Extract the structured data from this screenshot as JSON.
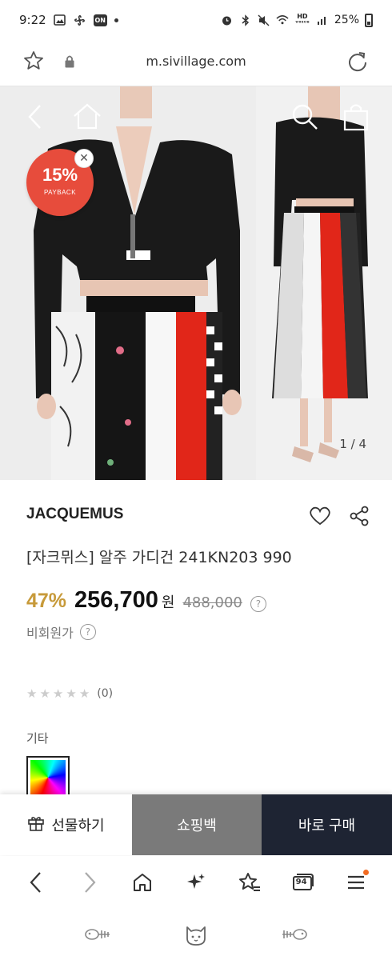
{
  "status_bar": {
    "time": "9:22",
    "battery": "25%",
    "on_badge": "ON"
  },
  "browser": {
    "url": "m.sivillage.com"
  },
  "hero": {
    "badge_percent": "15%",
    "badge_label": "PAYBACK",
    "pager": "1 / 4"
  },
  "product": {
    "brand": "JACQUEMUS",
    "name": "[자크뮈스] 알주 가디건 241KN203 990",
    "discount": "47%",
    "price": "256,700",
    "currency": "원",
    "original_price": "488,000",
    "member_price_label": "비회원가",
    "rating_count": "(0)",
    "rating_stars": 0,
    "option_label": "기타"
  },
  "actions": {
    "gift": "선물하기",
    "cart": "쇼핑백",
    "buy": "바로 구매"
  },
  "browser_nav": {
    "tab_count": "94"
  },
  "colors": {
    "discount": "#c79a3a",
    "badge": "#e74c3c",
    "cart_bg": "#7a7a7a",
    "buy_bg": "#1e2433",
    "notification": "#f26b21"
  }
}
